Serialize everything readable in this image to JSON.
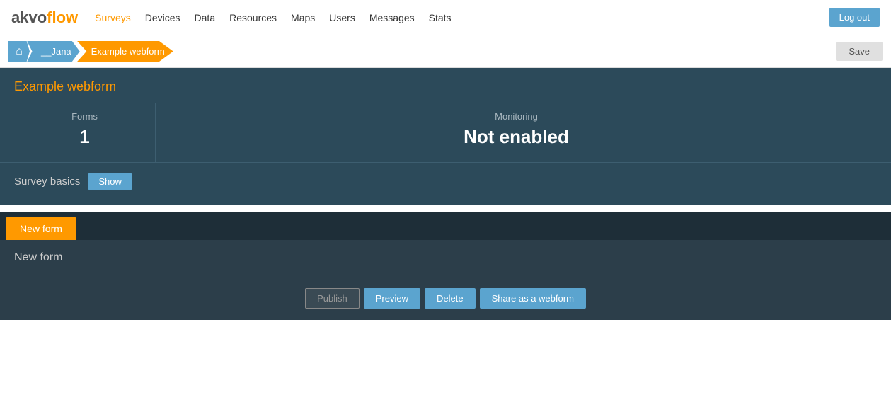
{
  "app": {
    "name_part1": "akvo",
    "name_part2": "flow"
  },
  "navbar": {
    "links": [
      {
        "label": "Surveys",
        "active": true
      },
      {
        "label": "Devices",
        "active": false
      },
      {
        "label": "Data",
        "active": false
      },
      {
        "label": "Resources",
        "active": false
      },
      {
        "label": "Maps",
        "active": false
      },
      {
        "label": "Users",
        "active": false
      },
      {
        "label": "Messages",
        "active": false
      },
      {
        "label": "Stats",
        "active": false
      }
    ],
    "logout_label": "Log out"
  },
  "breadcrumb": {
    "home_icon": "⌂",
    "items": [
      {
        "label": "__Jana"
      },
      {
        "label": "Example webform",
        "current": true
      }
    ],
    "save_label": "Save"
  },
  "survey": {
    "title": "Example webform",
    "stats": {
      "forms_label": "Forms",
      "forms_value": "1",
      "monitoring_label": "Monitoring",
      "monitoring_value": "Not enabled"
    },
    "basics_label": "Survey basics",
    "show_label": "Show"
  },
  "forms": {
    "tab_label": "New form",
    "form_name": "New form",
    "buttons": {
      "publish": "Publish",
      "preview": "Preview",
      "delete": "Delete",
      "share": "Share as a webform"
    }
  }
}
